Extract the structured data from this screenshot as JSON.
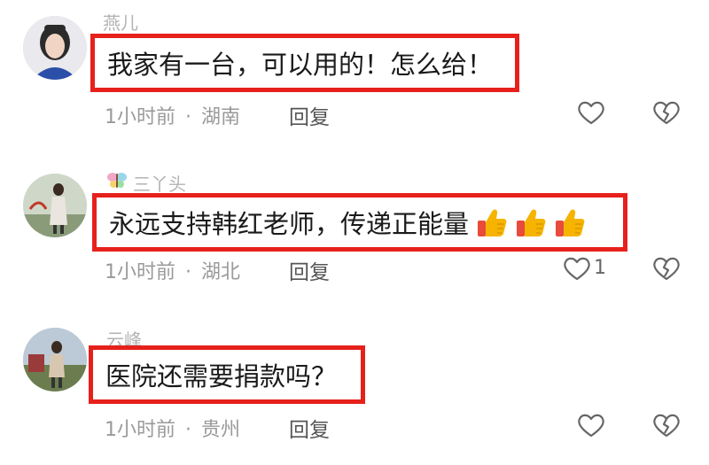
{
  "comments": [
    {
      "username": "燕儿",
      "badge_icon": "",
      "text": "我家有一台，可以用的！怎么给！",
      "time": "1小时前",
      "separator": "·",
      "location": "湖南",
      "reply_label": "回复",
      "like_count": "",
      "emoji": []
    },
    {
      "username": "三丫头",
      "badge_icon": "butterfly-icon",
      "text": "永远支持韩红老师，传递正能量",
      "time": "1小时前",
      "separator": "·",
      "location": "湖北",
      "reply_label": "回复",
      "like_count": "1",
      "emoji": [
        "thumbs-up-icon",
        "thumbs-up-icon",
        "thumbs-up-icon"
      ]
    },
    {
      "username": "云峰",
      "badge_icon": "",
      "text": "医院还需要捐款吗？",
      "time": "1小时前",
      "separator": "·",
      "location": "贵州",
      "reply_label": "回复",
      "like_count": "",
      "emoji": []
    }
  ],
  "colors": {
    "highlight_border": "#e6211c",
    "meta_text": "#9a9a9a",
    "username_text": "#b3b3b3",
    "thumb_yellow": "#f6b400",
    "thumb_cuff": "#e84a3c"
  }
}
